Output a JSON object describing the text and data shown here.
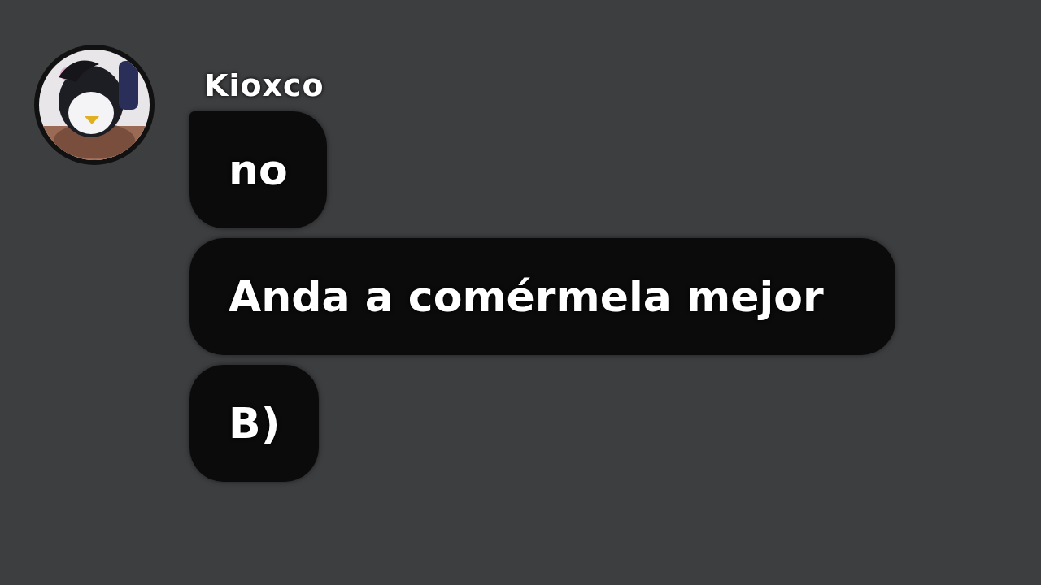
{
  "message_group": {
    "author": "Kioxco",
    "messages": [
      {
        "text": "no"
      },
      {
        "text": "Anda a comérmela mejor"
      },
      {
        "text": "B)"
      }
    ]
  }
}
